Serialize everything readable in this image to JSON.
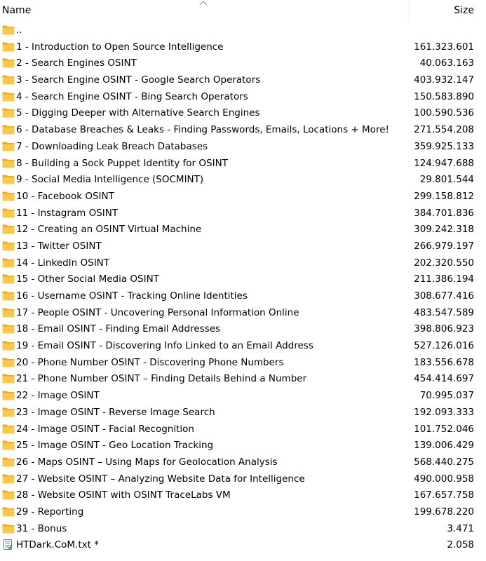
{
  "header": {
    "name_label": "Name",
    "size_label": "Size",
    "sort_icon": "chevron-up-icon"
  },
  "colors": {
    "folder_back": "#e8a92a",
    "folder_front": "#f8c94a",
    "text": "#000000"
  },
  "rows": [
    {
      "type": "folder",
      "name": "..",
      "size": ""
    },
    {
      "type": "folder",
      "name": "1 - Introduction to Open Source Intelligence",
      "size": "161.323.601"
    },
    {
      "type": "folder",
      "name": "2 - Search Engines OSINT",
      "size": "40.063.163"
    },
    {
      "type": "folder",
      "name": "3 - Search Engine OSINT - Google Search Operators",
      "size": "403.932.147"
    },
    {
      "type": "folder",
      "name": "4 - Search Engine OSINT - Bing Search Operators",
      "size": "150.583.890"
    },
    {
      "type": "folder",
      "name": "5 - Digging Deeper with Alternative Search Engines",
      "size": "100.590.536"
    },
    {
      "type": "folder",
      "name": "6 - Database Breaches & Leaks - Finding Passwords, Emails, Locations + More!",
      "size": "271.554.208"
    },
    {
      "type": "folder",
      "name": "7 - Downloading Leak  Breach Databases",
      "size": "359.925.133"
    },
    {
      "type": "folder",
      "name": "8 - Building a Sock Puppet Identity for OSINT",
      "size": "124.947.688"
    },
    {
      "type": "folder",
      "name": "9 - Social Media Intelligence (SOCMINT)",
      "size": "29.801.544"
    },
    {
      "type": "folder",
      "name": "10 - Facebook OSINT",
      "size": "299.158.812"
    },
    {
      "type": "folder",
      "name": "11 - Instagram OSINT",
      "size": "384.701.836"
    },
    {
      "type": "folder",
      "name": "12 - Creating an OSINT Virtual Machine",
      "size": "309.242.318"
    },
    {
      "type": "folder",
      "name": "13 - Twitter OSINT",
      "size": "266.979.197"
    },
    {
      "type": "folder",
      "name": "14 - LinkedIn OSINT",
      "size": "202.320.550"
    },
    {
      "type": "folder",
      "name": "15 - Other Social Media OSINT",
      "size": "211.386.194"
    },
    {
      "type": "folder",
      "name": "16 - Username OSINT - Tracking Online Identities",
      "size": "308.677.416"
    },
    {
      "type": "folder",
      "name": "17 - People OSINT - Uncovering Personal Information Online",
      "size": "483.547.589"
    },
    {
      "type": "folder",
      "name": "18 - Email OSINT - Finding Email Addresses",
      "size": "398.806.923"
    },
    {
      "type": "folder",
      "name": "19 - Email OSINT - Discovering Info Linked to an Email Address",
      "size": "527.126.016"
    },
    {
      "type": "folder",
      "name": "20 - Phone Number OSINT - Discovering Phone Numbers",
      "size": "183.556.678"
    },
    {
      "type": "folder",
      "name": "21 - Phone Number OSINT – Finding Details Behind a Number",
      "size": "454.414.697"
    },
    {
      "type": "folder",
      "name": "22 - Image OSINT",
      "size": "70.995.037"
    },
    {
      "type": "folder",
      "name": "23 - Image OSINT - Reverse Image Search",
      "size": "192.093.333"
    },
    {
      "type": "folder",
      "name": "24 - Image OSINT - Facial Recognition",
      "size": "101.752.046"
    },
    {
      "type": "folder",
      "name": "25 - Image OSINT - Geo Location Tracking",
      "size": "139.006.429"
    },
    {
      "type": "folder",
      "name": "26 - Maps OSINT – Using Maps for Geolocation Analysis",
      "size": "568.440.275"
    },
    {
      "type": "folder",
      "name": "27 - Website OSINT – Analyzing Website Data for Intelligence",
      "size": "490.000.958"
    },
    {
      "type": "folder",
      "name": "28 - Website OSINT with OSINT TraceLabs VM",
      "size": "167.657.758"
    },
    {
      "type": "folder",
      "name": "29 - Reporting",
      "size": "199.678.220"
    },
    {
      "type": "folder",
      "name": "31 - Bonus",
      "size": "3.471"
    },
    {
      "type": "file",
      "name": "HTDark.CoM.txt *",
      "size": "2.058"
    }
  ]
}
